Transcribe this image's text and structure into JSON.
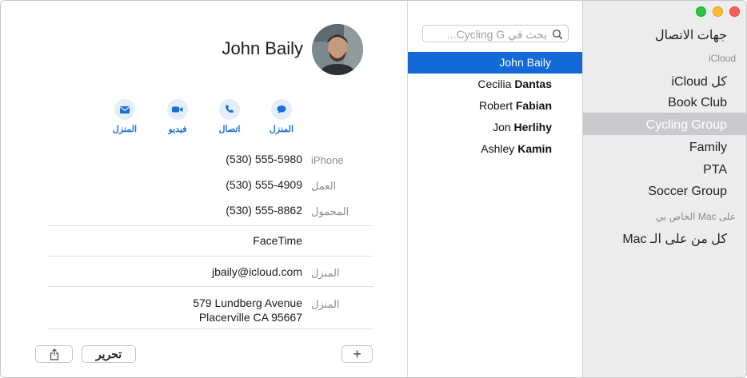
{
  "sidebar": {
    "title": "جهات الاتصال",
    "sections": [
      {
        "label": "iCloud"
      },
      {
        "label": "على Mac الخاص بي"
      }
    ],
    "items": [
      {
        "label": "كل iCloud"
      },
      {
        "label": "Book Club"
      },
      {
        "label": "Cycling Group"
      },
      {
        "label": "Family"
      },
      {
        "label": "PTA"
      },
      {
        "label": "Soccer Group"
      },
      {
        "label": "كل من على الـ Mac"
      }
    ],
    "selected": "Cycling Group"
  },
  "search": {
    "placeholder": "بحث في Cycling G..."
  },
  "contacts": [
    {
      "first": "John",
      "last": "Baily"
    },
    {
      "first": "Cecilia",
      "last": "Dantas"
    },
    {
      "first": "Robert",
      "last": "Fabian"
    },
    {
      "first": "Jon",
      "last": "Herlihy"
    },
    {
      "first": "Ashley",
      "last": "Kamin"
    }
  ],
  "contacts_selected": "John Baily",
  "detail": {
    "name": "John Baily",
    "actions": [
      {
        "label": "المنزل",
        "icon": "message-icon"
      },
      {
        "label": "اتصال",
        "icon": "phone-icon"
      },
      {
        "label": "فيديو",
        "icon": "video-icon"
      },
      {
        "label": "المنزل",
        "icon": "mail-icon"
      }
    ],
    "phones": [
      {
        "label": "iPhone",
        "value": "(530) 555-5980"
      },
      {
        "label": "العمل",
        "value": "(530) 555-4909"
      },
      {
        "label": "المحمول",
        "value": "(530) 555-8862"
      }
    ],
    "facetime": "FaceTime",
    "email": {
      "label": "المنزل",
      "value": "jbaily@icloud.com"
    },
    "address": {
      "label": "المنزل",
      "line1": "579 Lundberg Avenue",
      "line2": "Placerville CA 95667"
    }
  },
  "footer": {
    "add_label": "+",
    "edit_label": "تحرير",
    "share_icon": "share-icon"
  },
  "colors": {
    "accent": "#1369d6",
    "sidebar_bg": "#ececec",
    "sidebar_selected": "#c9c9ce"
  }
}
